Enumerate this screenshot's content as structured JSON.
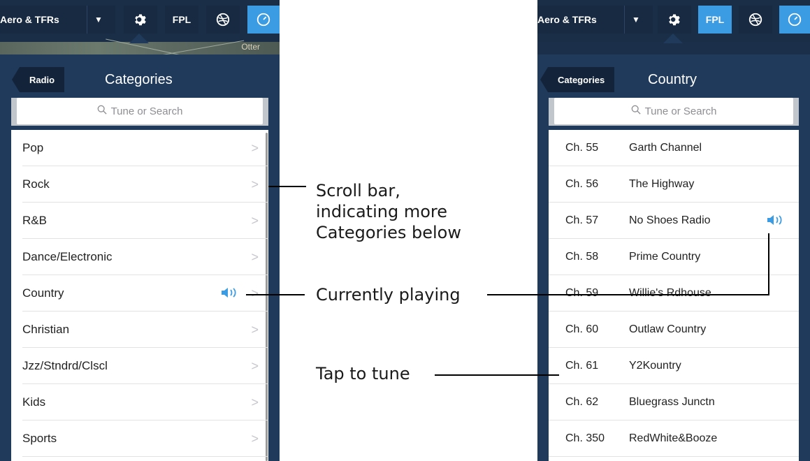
{
  "left": {
    "topbar": {
      "layer_label": "Aero & TFRs",
      "layer_dropdown_icon": "triangle-down-icon",
      "settings_icon": "gear-icon",
      "fpl_label": "FPL",
      "layers_icon": "globe-icon",
      "gauge_icon": "gauge-icon"
    },
    "map_label": "Otter",
    "back_label": "Radio",
    "title": "Categories",
    "search_placeholder": "Tune or Search",
    "rows": [
      {
        "label": "Pop"
      },
      {
        "label": "Rock"
      },
      {
        "label": "R&B"
      },
      {
        "label": "Dance/Electronic"
      },
      {
        "label": "Country",
        "playing": true
      },
      {
        "label": "Christian"
      },
      {
        "label": "Jzz/Stndrd/Clscl"
      },
      {
        "label": "Kids"
      },
      {
        "label": "Sports"
      }
    ]
  },
  "right": {
    "topbar": {
      "layer_label": "Aero & TFRs",
      "fpl_label": "FPL"
    },
    "back_label": "Categories",
    "title": "Country",
    "search_placeholder": "Tune or Search",
    "rows": [
      {
        "channel": "Ch. 55",
        "name": "Garth Channel"
      },
      {
        "channel": "Ch. 56",
        "name": "The Highway"
      },
      {
        "channel": "Ch. 57",
        "name": "No Shoes Radio",
        "playing": true
      },
      {
        "channel": "Ch. 58",
        "name": "Prime Country"
      },
      {
        "channel": "Ch. 59",
        "name": "Willie's Rdhouse"
      },
      {
        "channel": "Ch. 60",
        "name": "Outlaw Country"
      },
      {
        "channel": "Ch. 61",
        "name": "Y2Kountry"
      },
      {
        "channel": "Ch. 62",
        "name": "Bluegrass Junctn"
      },
      {
        "channel": "Ch. 350",
        "name": "RedWhite&Booze"
      }
    ]
  },
  "annotations": {
    "scroll_bar": [
      "Scroll bar,",
      "indicating more",
      "Categories below"
    ],
    "currently_playing": "Currently playing",
    "tap_to_tune": "Tap to tune"
  },
  "colors": {
    "accent": "#3b9be3",
    "panel_bg": "#1f3a5b",
    "topbar_bg": "#1a2e47"
  }
}
